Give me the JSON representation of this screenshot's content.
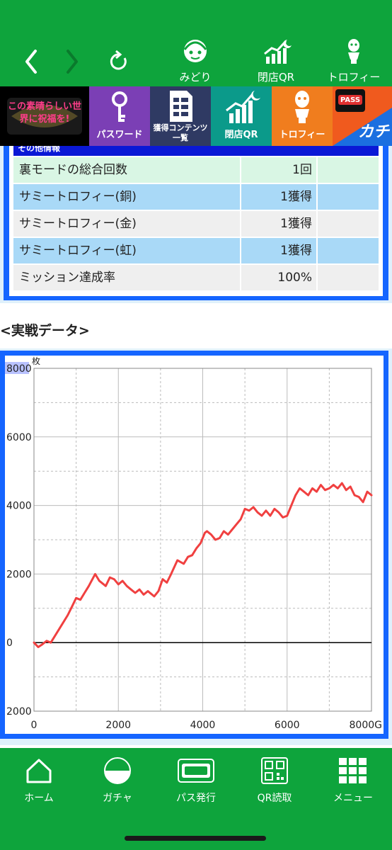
{
  "topbar": {
    "items": [
      {
        "label": "みどり",
        "icon": "character-face-icon"
      },
      {
        "label": "閉店QR",
        "icon": "chart-moon-icon"
      },
      {
        "label": "トロフィー",
        "icon": "trophy-figure-icon"
      }
    ]
  },
  "banner": {
    "logo_text": "この素晴らしい世界に祝福を!",
    "tiles": [
      {
        "label": "パスワード",
        "icon": "key-icon",
        "color": "#7b3fb5"
      },
      {
        "label": "獲得コンテンツ\n一覧",
        "icon": "document-icon",
        "color": "#2f3a63"
      },
      {
        "label": "閉店QR",
        "icon": "chart-moon-icon",
        "color": "#0b9a8a"
      },
      {
        "label": "トロフィー",
        "icon": "trophy-figure-icon",
        "color": "#f07d1e"
      },
      {
        "label": "PASS",
        "icon": "pass-icon",
        "color": "#1b6fe0"
      }
    ],
    "side_text": "カチ"
  },
  "info": {
    "header": "その他情報",
    "rows": [
      {
        "label": "裏モードの総合回数",
        "value": "1回"
      },
      {
        "label": "サミートロフィー(銅)",
        "value": "1獲得"
      },
      {
        "label": "サミートロフィー(金)",
        "value": "1獲得"
      },
      {
        "label": "サミートロフィー(虹)",
        "value": "1獲得"
      },
      {
        "label": "ミッション達成率",
        "value": "100%"
      }
    ]
  },
  "section": {
    "title": "<実戦データ>"
  },
  "chart_data": {
    "type": "line",
    "title": "",
    "ylabel": "枚",
    "xlabel": "",
    "x_unit": "G",
    "xlim": [
      0,
      8000
    ],
    "ylim": [
      -2000,
      8000
    ],
    "x_ticks": [
      0,
      2000,
      4000,
      6000,
      8000
    ],
    "y_ticks": [
      -2000,
      0,
      2000,
      4000,
      6000,
      8000
    ],
    "x_tick_labels": [
      "0",
      "2000",
      "4000",
      "6000",
      "8000G"
    ],
    "y_tick_labels": [
      "2000",
      "0",
      "2000",
      "4000",
      "6000",
      "8000"
    ],
    "grid": true,
    "line_color": "#f04040",
    "series": [
      {
        "x": [
          0,
          100,
          200,
          300,
          400,
          600,
          800,
          900,
          1000,
          1100,
          1200,
          1300,
          1450,
          1550,
          1700,
          1800,
          1900,
          2000,
          2100,
          2200,
          2300,
          2400,
          2500,
          2600,
          2700,
          2800,
          2850,
          2950,
          3050,
          3150,
          3250,
          3400,
          3550,
          3650,
          3750,
          3850,
          3950,
          4050,
          4100,
          4200,
          4300,
          4400,
          4500,
          4600,
          4700,
          4800,
          4900,
          5000,
          5100,
          5200,
          5300,
          5400,
          5500,
          5600,
          5700,
          5800,
          5900,
          6000,
          6100,
          6200,
          6300,
          6400,
          6500,
          6600,
          6700,
          6800,
          6900,
          7000,
          7100,
          7200,
          7300,
          7400,
          7500,
          7600,
          7700,
          7800,
          7900,
          8000
        ],
        "y": [
          0,
          -130,
          -50,
          50,
          0,
          400,
          800,
          1050,
          1300,
          1250,
          1450,
          1650,
          2000,
          1800,
          1650,
          1900,
          1850,
          1700,
          1800,
          1650,
          1550,
          1450,
          1550,
          1400,
          1500,
          1400,
          1350,
          1500,
          1850,
          1750,
          2000,
          2400,
          2300,
          2500,
          2550,
          2750,
          2900,
          3200,
          3250,
          3150,
          3000,
          3050,
          3250,
          3150,
          3300,
          3450,
          3600,
          3900,
          3850,
          3950,
          3800,
          3700,
          3850,
          3700,
          3900,
          3800,
          3650,
          3700,
          4000,
          4300,
          4500,
          4400,
          4300,
          4500,
          4400,
          4600,
          4450,
          4500,
          4600,
          4500,
          4650,
          4450,
          4550,
          4300,
          4250,
          4100,
          4400,
          4300
        ]
      }
    ]
  },
  "bottombar": {
    "items": [
      {
        "label": "ホーム",
        "icon": "home-icon"
      },
      {
        "label": "ガチャ",
        "icon": "gacha-capsule-icon"
      },
      {
        "label": "パス発行",
        "icon": "push-pass-icon"
      },
      {
        "label": "QR読取",
        "icon": "qr-code-icon"
      },
      {
        "label": "メニュー",
        "icon": "menu-grid-icon"
      }
    ]
  }
}
